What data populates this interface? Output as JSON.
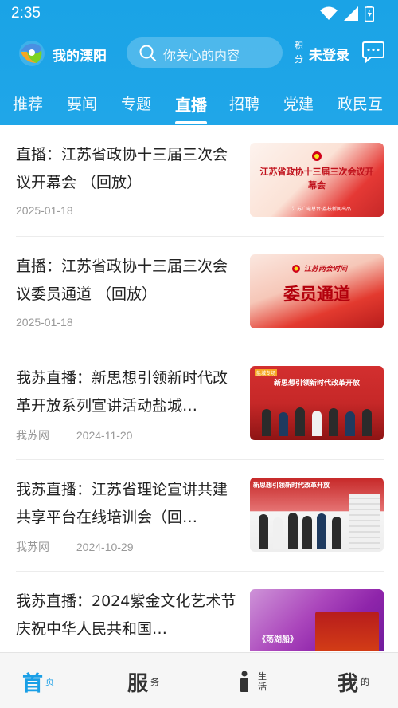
{
  "status_bar": {
    "time": "2:35"
  },
  "header": {
    "app_name": "我的溧阳",
    "search_placeholder": "你关心的内容",
    "points_label": "积分",
    "login_text": "未登录",
    "brand_color": "#1aa3e6"
  },
  "tabs": [
    {
      "label": "推荐",
      "active": false
    },
    {
      "label": "要闻",
      "active": false
    },
    {
      "label": "专题",
      "active": false
    },
    {
      "label": "直播",
      "active": true
    },
    {
      "label": "招聘",
      "active": false
    },
    {
      "label": "党建",
      "active": false
    },
    {
      "label": "政民互",
      "active": false
    }
  ],
  "news": [
    {
      "title": "直播：江苏省政协十三届三次会议开幕会 （回放）",
      "source": "",
      "date": "2025-01-18",
      "thumb_text": "江苏省政协十三届三次会议开幕会",
      "thumb_caption": "江苏广电总台·荔枝新闻出品"
    },
    {
      "title": "直播：江苏省政协十三届三次会议委员通道 （回放）",
      "source": "",
      "date": "2025-01-18",
      "thumb_text": "委员通道",
      "thumb_caption": "江苏两会时间"
    },
    {
      "title": "我苏直播：新思想引领新时代改革开放系列宣讲活动盐城…",
      "source": "我苏网",
      "date": "2024-11-20",
      "thumb_text": "新思想引领新时代改革开放",
      "thumb_caption": "盐城专场"
    },
    {
      "title": "我苏直播：江苏省理论宣讲共建共享平台在线培训会（回…",
      "source": "我苏网",
      "date": "2024-10-29",
      "thumb_text": "新思想引领新时代改革开放",
      "thumb_caption": ""
    },
    {
      "title": "我苏直播：2024紫金文化艺术节 庆祝中华人民共和国…",
      "source": "",
      "date": "",
      "thumb_text": "《荡湖船》",
      "thumb_caption": ""
    }
  ],
  "bottom_nav": [
    {
      "big": "首",
      "small": "页",
      "active": true
    },
    {
      "big": "服",
      "small": "务",
      "active": false
    },
    {
      "big": "",
      "small": "生活",
      "active": false
    },
    {
      "big": "我",
      "small": "的",
      "active": false
    }
  ]
}
